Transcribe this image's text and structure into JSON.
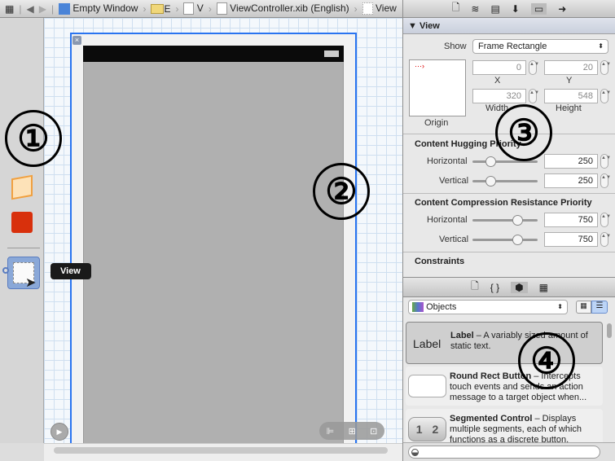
{
  "breadcrumb": {
    "items": [
      "Empty Window",
      "E",
      "V",
      "ViewController.xib (English)",
      "View"
    ]
  },
  "dock": {
    "tooltip": "View"
  },
  "annotations": [
    "①",
    "②",
    "③",
    "④"
  ],
  "inspector": {
    "section": "View",
    "show_label": "Show",
    "show_value": "Frame Rectangle",
    "origin_label": "Origin",
    "x": "0",
    "y": "20",
    "width": "320",
    "height": "548",
    "x_label": "X",
    "y_label": "Y",
    "width_label": "Width",
    "height_label": "Height",
    "hugging": {
      "title": "Content Hugging Priority",
      "horizontal_label": "Horizontal",
      "horizontal": "250",
      "vertical_label": "Vertical",
      "vertical": "250"
    },
    "compression": {
      "title": "Content Compression Resistance Priority",
      "horizontal_label": "Horizontal",
      "horizontal": "750",
      "vertical_label": "Vertical",
      "vertical": "750"
    },
    "constraints": "Constraints"
  },
  "library": {
    "popup": "Objects",
    "items": [
      {
        "icon": "Label",
        "title": "Label",
        "desc": " – A variably sized amount of static text."
      },
      {
        "icon": "",
        "title": "Round Rect Button",
        "desc": " – Intercepts touch events and sends an action message to a target object when..."
      },
      {
        "icon": "1 2",
        "title": "Segmented Control",
        "desc": " – Displays multiple segments, each of which functions as a discrete button."
      }
    ]
  },
  "colors": {
    "accent": "#2a74f0"
  }
}
